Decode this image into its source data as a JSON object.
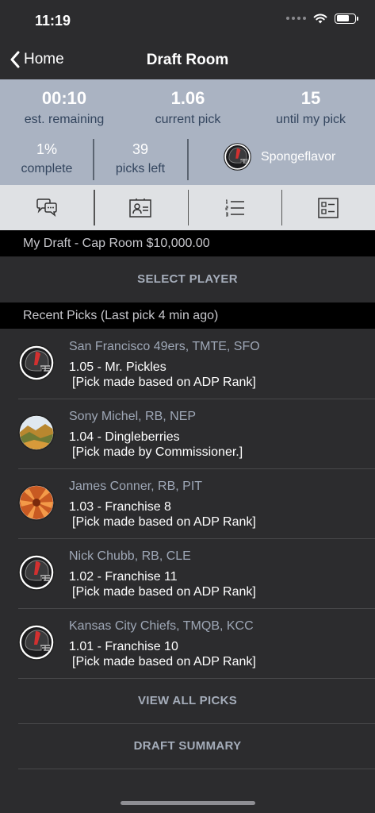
{
  "status_bar": {
    "time": "11:19"
  },
  "nav": {
    "back_label": "Home",
    "title": "Draft Room"
  },
  "stats": {
    "est_remaining": {
      "value": "00:10",
      "label": "est. remaining"
    },
    "current_pick": {
      "value": "1.06",
      "label": "current pick"
    },
    "until_my_pick": {
      "value": "15",
      "label": "until my pick"
    },
    "complete": {
      "value": "1%",
      "label": "complete"
    },
    "picks_left": {
      "value": "39",
      "label": "picks left"
    },
    "user": {
      "name": "Spongeflavor"
    }
  },
  "toolbar": {
    "icons": [
      "chat-bubbles-icon",
      "player-card-icon",
      "ranked-list-icon",
      "board-list-icon"
    ]
  },
  "my_draft": {
    "header": "My Draft - Cap Room $10,000.00",
    "select_label": "SELECT PLAYER"
  },
  "recent": {
    "header": "Recent Picks (Last pick 4 min ago)",
    "picks": [
      {
        "player": "San Francisco 49ers, TMTE, SFO",
        "pick": "1.05 - Mr. Pickles",
        "note": "[Pick made based on ADP Rank]",
        "avatar": "helmet"
      },
      {
        "player": "Sony Michel, RB, NEP",
        "pick": "1.04 - Dingleberries",
        "note": "[Pick made by Commissioner.]",
        "avatar": "landscape"
      },
      {
        "player": "James Conner, RB, PIT",
        "pick": "1.03 - Franchise 8",
        "note": "[Pick made based on ADP Rank]",
        "avatar": "flower"
      },
      {
        "player": "Nick Chubb, RB, CLE",
        "pick": "1.02 - Franchise 11",
        "note": "[Pick made based on ADP Rank]",
        "avatar": "helmet"
      },
      {
        "player": "Kansas City Chiefs, TMQB, KCC",
        "pick": "1.01 - Franchise 10",
        "note": "[Pick made based on ADP Rank]",
        "avatar": "helmet"
      }
    ],
    "view_all_label": "VIEW ALL PICKS",
    "summary_label": "DRAFT SUMMARY"
  },
  "colors": {
    "stats_bg": "#aab3c2",
    "label_blue": "#33455e",
    "button_text": "#a5adba",
    "page_bg": "#2c2c2e"
  }
}
